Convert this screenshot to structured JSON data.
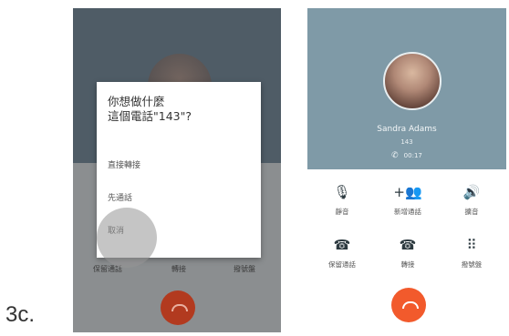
{
  "figure_label": "3c.",
  "left_phone": {
    "dialog_title": "你想做什麼\n這個電話\"143\"?",
    "options": [
      "直接轉接",
      "先通話",
      "取消"
    ],
    "button_labels": [
      "保留通話",
      "轉接",
      "撥號盤"
    ]
  },
  "right_phone": {
    "contact_name": "Sandra Adams",
    "contact_number": "143",
    "call_timer": "00:17",
    "controls_row1": [
      {
        "icon": "mic-off-icon",
        "glyph": "🎙",
        "label": "靜音"
      },
      {
        "icon": "add-call-icon",
        "glyph": "+👥",
        "label": "新增通話"
      },
      {
        "icon": "speaker-icon",
        "glyph": "🔊",
        "label": "擴音"
      }
    ],
    "controls_row2": [
      {
        "icon": "hold-call-icon",
        "glyph": "☎",
        "label": "保留通話"
      },
      {
        "icon": "transfer-call-icon",
        "glyph": "☎",
        "label": "轉接"
      },
      {
        "icon": "dialpad-icon",
        "glyph": "⠿",
        "label": "撥號盤"
      }
    ]
  },
  "colors": {
    "end_call_active": "#f25a2c",
    "header_bg": "#7f9aa7",
    "dim_overlay": "#8b8e90"
  }
}
